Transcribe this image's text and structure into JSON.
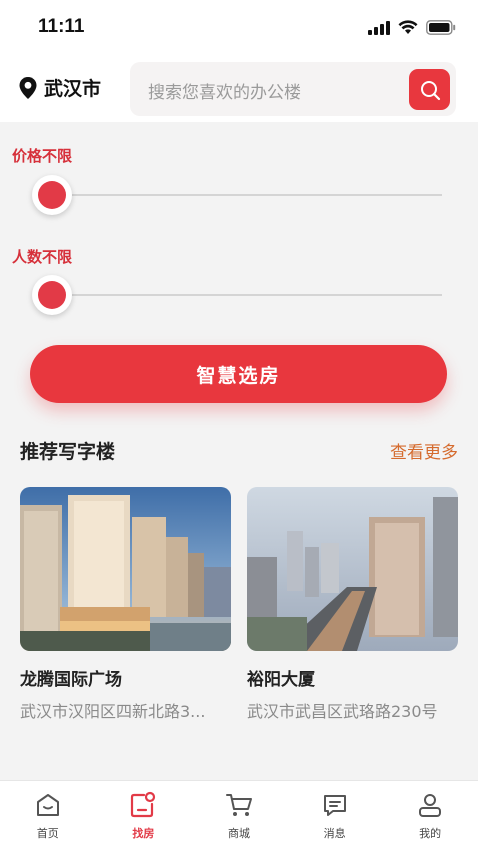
{
  "status": {
    "time": "11:11"
  },
  "header": {
    "city": "武汉市",
    "search_placeholder": "搜索您喜欢的办公楼"
  },
  "filters": [
    {
      "label": "价格不限",
      "level": 0
    },
    {
      "label": "人数不限",
      "level": 0
    }
  ],
  "smart_button": "智慧选房",
  "recommend": {
    "title": "推荐写字楼",
    "more": "查看更多",
    "items": [
      {
        "name": "龙腾国际广场",
        "address": "武汉市汉阳区四新北路3..."
      },
      {
        "name": "裕阳大厦",
        "address": "武汉市武昌区武珞路230号"
      }
    ]
  },
  "tabs": [
    {
      "label": "首页",
      "icon": "home-icon",
      "active": false
    },
    {
      "label": "找房",
      "icon": "find-house-icon",
      "active": true
    },
    {
      "label": "商城",
      "icon": "cart-icon",
      "active": false
    },
    {
      "label": "消息",
      "icon": "message-icon",
      "active": false
    },
    {
      "label": "我的",
      "icon": "profile-icon",
      "active": false
    }
  ],
  "colors": {
    "accent": "#e8373e",
    "more_link": "#d56b2e",
    "background": "#f3f3f3"
  }
}
